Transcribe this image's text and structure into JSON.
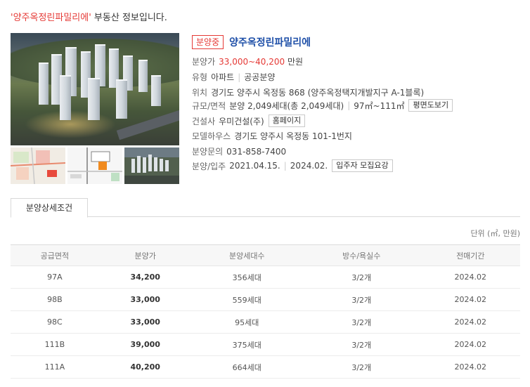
{
  "headline": {
    "name": "'양주옥정린파밀리에'",
    "rest": " 부동산 정보입니다."
  },
  "listing": {
    "status": "분양중",
    "title": "양주옥정린파밀리에",
    "price_label": "분양가",
    "price": "33,000~40,200",
    "price_unit": "만원",
    "type_label": "유형",
    "type": "아파트",
    "supply_type": "공공분양",
    "location_label": "위치",
    "location": "경기도 양주시 옥정동 868 (양주옥정택지개발지구 A-1블록)",
    "scale_label": "규모/면적",
    "scale": "분양 2,049세대(총 2,049세대)",
    "area": "97㎡~111㎡",
    "floorplan_btn": "평면도보기",
    "builder_label": "건설사",
    "builder": "우미건설(주)",
    "homepage_btn": "홈페이지",
    "modelhouse_label": "모델하우스",
    "modelhouse": "경기도 양주시 옥정동 101-1번지",
    "inquiry_label": "분양문의",
    "inquiry": "031-858-7400",
    "schedule_label": "분양/입주",
    "sale_date": "2021.04.15.",
    "move_in_date": "2024.02.",
    "notice_btn": "입주자 모집요강"
  },
  "tabs": {
    "detail": "분양상세조건"
  },
  "unit_note": "단위 (㎡, 만원)",
  "table": {
    "headers": [
      "공급면적",
      "분양가",
      "분양세대수",
      "방수/욕실수",
      "전매기간"
    ],
    "rows": [
      [
        "97A",
        "34,200",
        "356세대",
        "3/2개",
        "2024.02"
      ],
      [
        "98B",
        "33,000",
        "559세대",
        "3/2개",
        "2024.02"
      ],
      [
        "98C",
        "33,000",
        "95세대",
        "3/2개",
        "2024.02"
      ],
      [
        "111B",
        "39,000",
        "375세대",
        "3/2개",
        "2024.02"
      ],
      [
        "111A",
        "40,200",
        "664세대",
        "3/2개",
        "2024.02"
      ]
    ]
  }
}
